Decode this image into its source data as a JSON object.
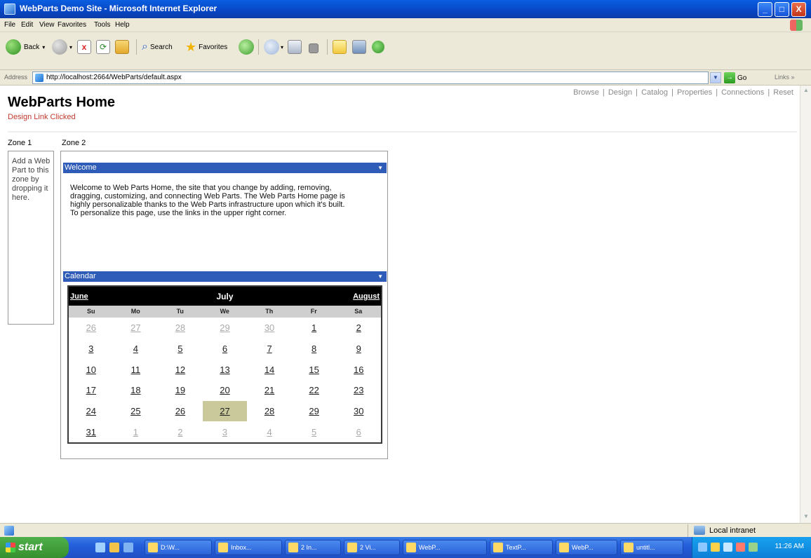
{
  "window": {
    "title": "WebParts Demo Site - Microsoft Internet Explorer",
    "minimize": "_",
    "maximize": "□",
    "close": "X"
  },
  "menubar": {
    "items": [
      "File",
      "Edit",
      "View",
      "Favorites",
      "Tools",
      "Help"
    ]
  },
  "toolbar": {
    "back_label": "Back",
    "search_label": "Search",
    "favorites_label": "Favorites"
  },
  "addressbar": {
    "label": "Address",
    "url": "http://localhost:2664/WebParts/default.aspx",
    "go_label": "Go",
    "links_label": "Links"
  },
  "page": {
    "nav_links": [
      "Browse",
      "Design",
      "Catalog",
      "Properties",
      "Connections",
      "Reset"
    ],
    "nav_separator": "|",
    "title": "WebParts Home",
    "status": "Design Link Clicked",
    "zone1_label": "Zone 1",
    "zone2_label": "Zone 2",
    "zone1_empty_text": "Add a Web Part to this zone by dropping it here.",
    "welcome_part": {
      "title": "Welcome",
      "text": "Welcome to Web Parts Home, the site that you change by adding, removing, dragging, customizing, and connecting Web Parts. The Web Parts Home page is highly personalizable thanks to the Web Parts infrastructure upon which it's built. To personalize this page, use the links in the upper right corner."
    },
    "calendar_part": {
      "title": "Calendar",
      "prev_month": "June",
      "month": "July",
      "next_month": "August",
      "day_headers": [
        "Su",
        "Mo",
        "Tu",
        "We",
        "Th",
        "Fr",
        "Sa"
      ],
      "days": [
        {
          "d": "26",
          "other": true
        },
        {
          "d": "27",
          "other": true
        },
        {
          "d": "28",
          "other": true
        },
        {
          "d": "29",
          "other": true
        },
        {
          "d": "30",
          "other": true
        },
        {
          "d": "1"
        },
        {
          "d": "2"
        },
        {
          "d": "3"
        },
        {
          "d": "4"
        },
        {
          "d": "5"
        },
        {
          "d": "6"
        },
        {
          "d": "7"
        },
        {
          "d": "8"
        },
        {
          "d": "9"
        },
        {
          "d": "10"
        },
        {
          "d": "11"
        },
        {
          "d": "12"
        },
        {
          "d": "13"
        },
        {
          "d": "14"
        },
        {
          "d": "15"
        },
        {
          "d": "16"
        },
        {
          "d": "17"
        },
        {
          "d": "18"
        },
        {
          "d": "19"
        },
        {
          "d": "20"
        },
        {
          "d": "21"
        },
        {
          "d": "22"
        },
        {
          "d": "23"
        },
        {
          "d": "24"
        },
        {
          "d": "25"
        },
        {
          "d": "26"
        },
        {
          "d": "27",
          "selected": true
        },
        {
          "d": "28"
        },
        {
          "d": "29"
        },
        {
          "d": "30"
        },
        {
          "d": "31"
        },
        {
          "d": "1",
          "other": true
        },
        {
          "d": "2",
          "other": true
        },
        {
          "d": "3",
          "other": true
        },
        {
          "d": "4",
          "other": true
        },
        {
          "d": "5",
          "other": true
        },
        {
          "d": "6",
          "other": true
        }
      ]
    }
  },
  "statusbar": {
    "zone": "Local intranet"
  },
  "taskbar": {
    "start_label": "start",
    "tasks": [
      "D:\\W...",
      "Inbox...",
      "2 In...",
      "2 Vi...",
      "WebP...",
      "TextP...",
      "WebP...",
      "untitl..."
    ],
    "clock": "11:26 AM"
  },
  "colors": {
    "part_title_bg": "#2e5cb8",
    "status_text": "#c3382c",
    "selected_day_bg": "#c9c99c"
  }
}
